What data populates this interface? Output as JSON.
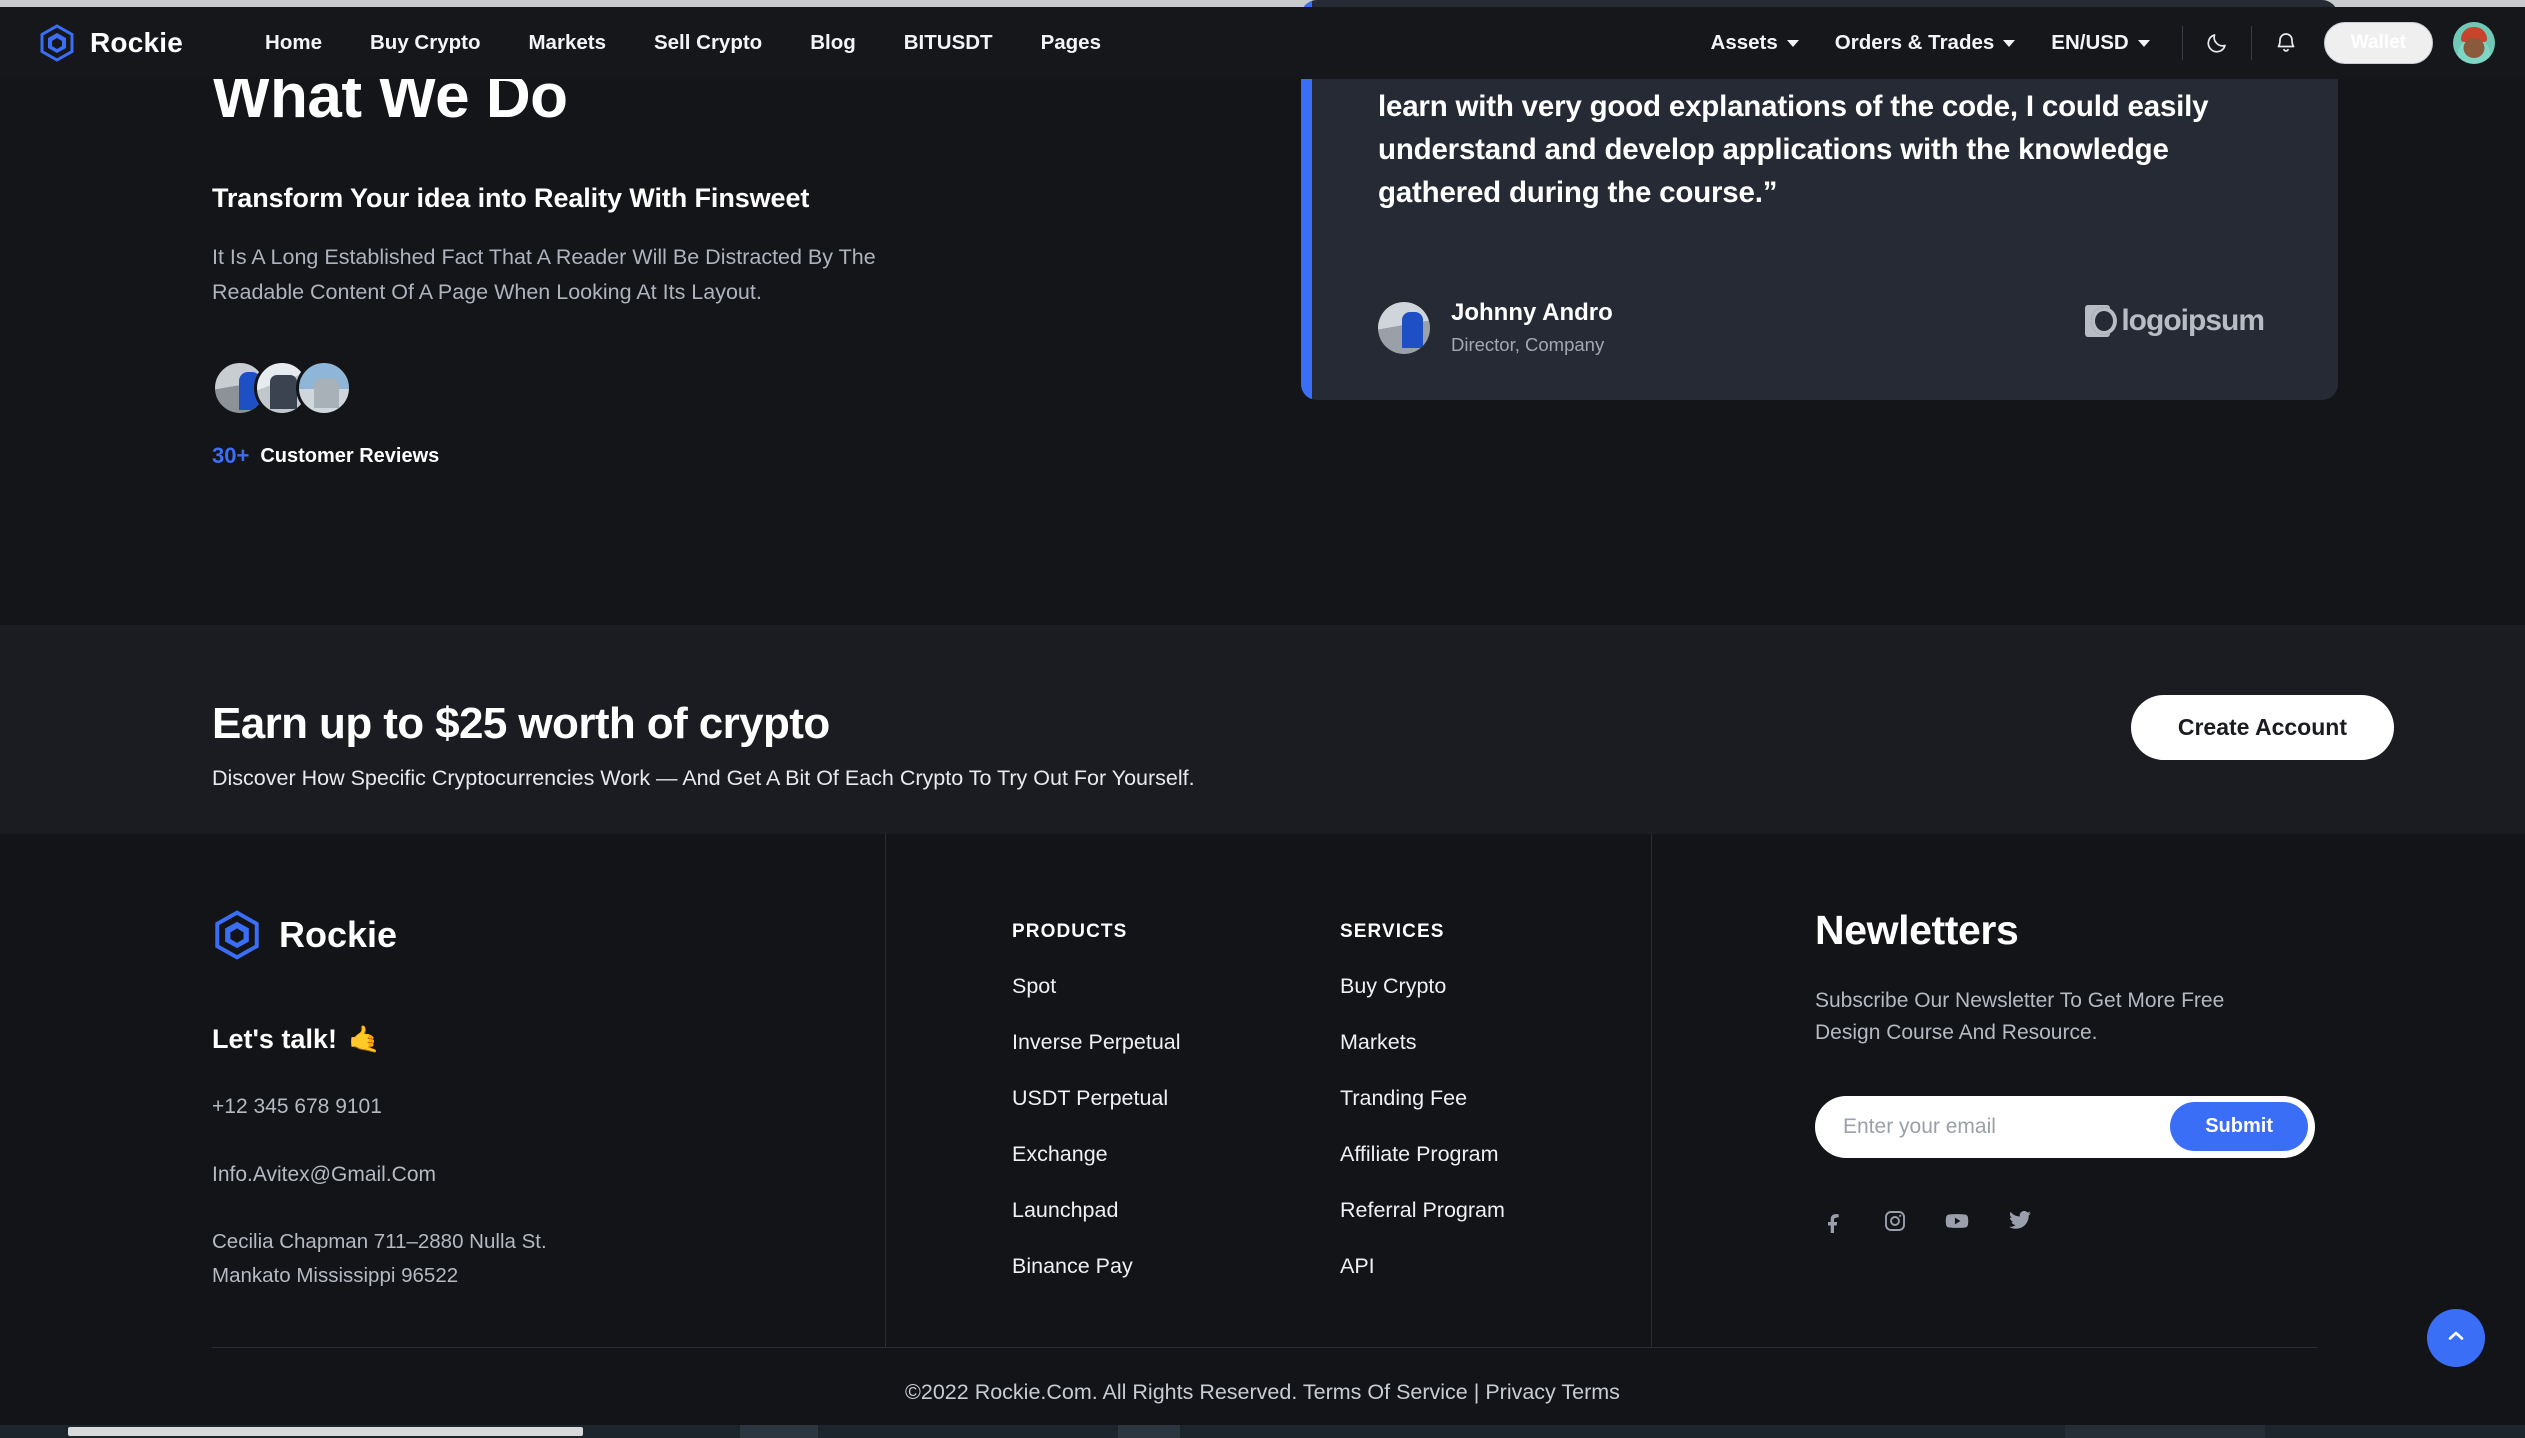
{
  "brand": {
    "name": "Rockie"
  },
  "nav": {
    "links": [
      {
        "label": "Home"
      },
      {
        "label": "Buy Crypto"
      },
      {
        "label": "Markets"
      },
      {
        "label": "Sell Crypto"
      },
      {
        "label": "Blog"
      },
      {
        "label": "BITUSDT"
      },
      {
        "label": "Pages"
      }
    ],
    "dropdowns": [
      {
        "label": "Assets"
      },
      {
        "label": "Orders & Trades"
      },
      {
        "label": "EN/USD"
      }
    ],
    "theme_icon": "moon-icon",
    "notification_icon": "bell-icon",
    "wallet_label": "Wallet",
    "avatar": "user-avatar"
  },
  "hero": {
    "title": "What We Do",
    "subhead": "Transform Your idea into Reality With Finsweet",
    "body": "It Is A Long Established Fact That A Reader Will Be Distracted By The Readable Content Of A Page When Looking At Its Layout.",
    "reviews_count": "30+",
    "reviews_label": "Customer Reviews"
  },
  "testimonial": {
    "quote": "Great course ! really enjoyed it and the course was way easy to learn with very good explanations of the code, I could easily understand and develop applications with the knowledge gathered during the course.”",
    "author_name": "Johnny Andro",
    "author_role": "Director, Company",
    "company_logo": "logoipsum",
    "accent_color": "#3b6ef6"
  },
  "cta": {
    "title": "Earn up to $25 worth of crypto",
    "subtitle": "Discover How Specific Cryptocurrencies Work — And Get A Bit Of Each Crypto To Try Out For Yourself.",
    "button_label": "Create Account"
  },
  "footer": {
    "brand_name": "Rockie",
    "lets_talk": "Let's talk!",
    "lets_talk_emoji": "🤙",
    "phone": "+12 345 678 9101",
    "email": "Info.Avitex@Gmail.Com",
    "address_line1": "Cecilia Chapman 711–2880 Nulla St.",
    "address_line2": "Mankato Mississippi 96522",
    "products": {
      "heading": "PRODUCTS",
      "items": [
        {
          "label": "Spot"
        },
        {
          "label": "Inverse Perpetual"
        },
        {
          "label": "USDT Perpetual"
        },
        {
          "label": "Exchange"
        },
        {
          "label": "Launchpad"
        },
        {
          "label": "Binance Pay"
        }
      ]
    },
    "services": {
      "heading": "SERVICES",
      "items": [
        {
          "label": "Buy Crypto"
        },
        {
          "label": "Markets"
        },
        {
          "label": "Tranding Fee"
        },
        {
          "label": "Affiliate Program"
        },
        {
          "label": "Referral Program"
        },
        {
          "label": "API"
        }
      ]
    },
    "newsletter": {
      "title": "Newletters",
      "subtitle": "Subscribe Our Newsletter To Get More Free Design Course And Resource.",
      "input_value": "",
      "input_placeholder": "Enter your email",
      "submit_label": "Submit",
      "socials": [
        {
          "name": "facebook-icon"
        },
        {
          "name": "instagram-icon"
        },
        {
          "name": "youtube-icon"
        },
        {
          "name": "twitter-icon"
        }
      ]
    },
    "copyright": "©2022 Rockie.Com. All Rights Reserved. ",
    "terms_label": "Terms Of Service",
    "divider": " | ",
    "privacy_label": "Privacy Terms"
  },
  "scroll_top_icon": "chevron-up-icon",
  "colors": {
    "accent": "#3b6ef6",
    "bg": "#141518",
    "card": "#262a35"
  }
}
